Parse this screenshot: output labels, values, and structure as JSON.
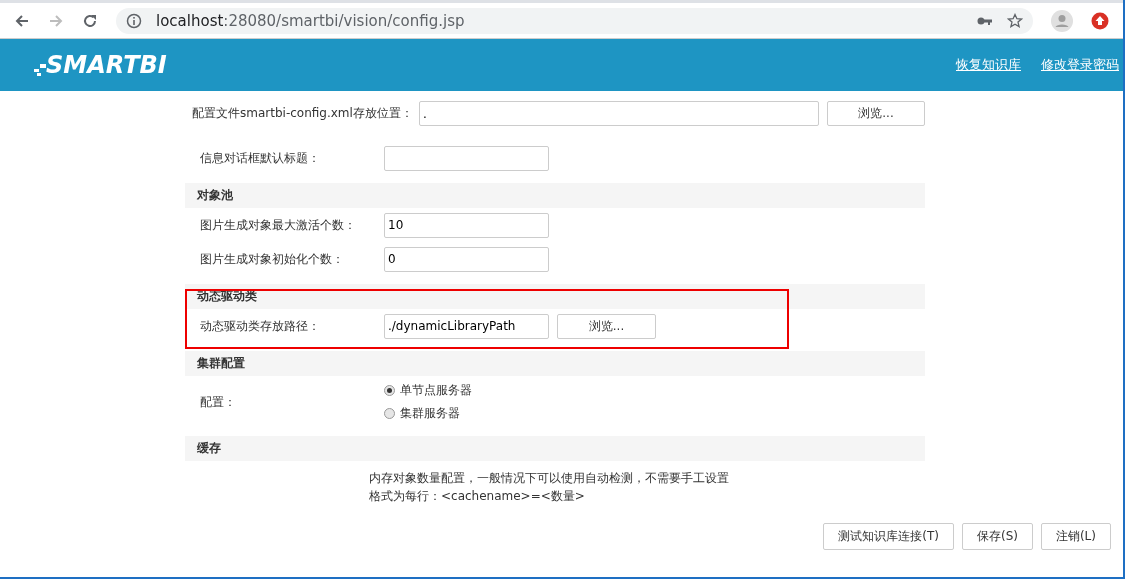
{
  "browser": {
    "url_host": "localhost",
    "url_path": ":28080/smartbi/vision/config.jsp"
  },
  "header": {
    "logo": "SMARTBI",
    "links": [
      "恢复知识库",
      "修改登录密码"
    ]
  },
  "sections": [
    {
      "highlighted": false,
      "rows": [
        {
          "kind": "file_wide",
          "label": "配置文件smartbi-config.xml存放位置：",
          "value": ".",
          "button": "浏览..."
        },
        {
          "kind": "text",
          "label": "信息对话框默认标题：",
          "value": ""
        }
      ]
    },
    {
      "title": "对象池",
      "highlighted": false,
      "rows": [
        {
          "kind": "text",
          "label": "图片生成对象最大激活个数：",
          "value": "10"
        },
        {
          "kind": "text",
          "label": "图片生成对象初始化个数：",
          "value": "0"
        }
      ]
    },
    {
      "title": "动态驱动类",
      "highlighted": true,
      "rows": [
        {
          "kind": "file",
          "label": "动态驱动类存放路径：",
          "value": "./dynamicLibraryPath",
          "button": "浏览..."
        }
      ]
    },
    {
      "title": "集群配置",
      "highlighted": false,
      "rows": [
        {
          "kind": "radio",
          "label": "配置：",
          "options": [
            {
              "label": "单节点服务器",
              "selected": true
            },
            {
              "label": "集群服务器",
              "selected": false
            }
          ]
        }
      ]
    },
    {
      "title": "缓存",
      "highlighted": false,
      "rows": [
        {
          "kind": "note",
          "lines": [
            "内存对象数量配置，一般情况下可以使用自动检测，不需要手工设置",
            "格式为每行：<cachename>=<数量>"
          ]
        }
      ]
    }
  ],
  "buttons": [
    "测试知识库连接(T)",
    "保存(S)",
    "注销(L)"
  ]
}
